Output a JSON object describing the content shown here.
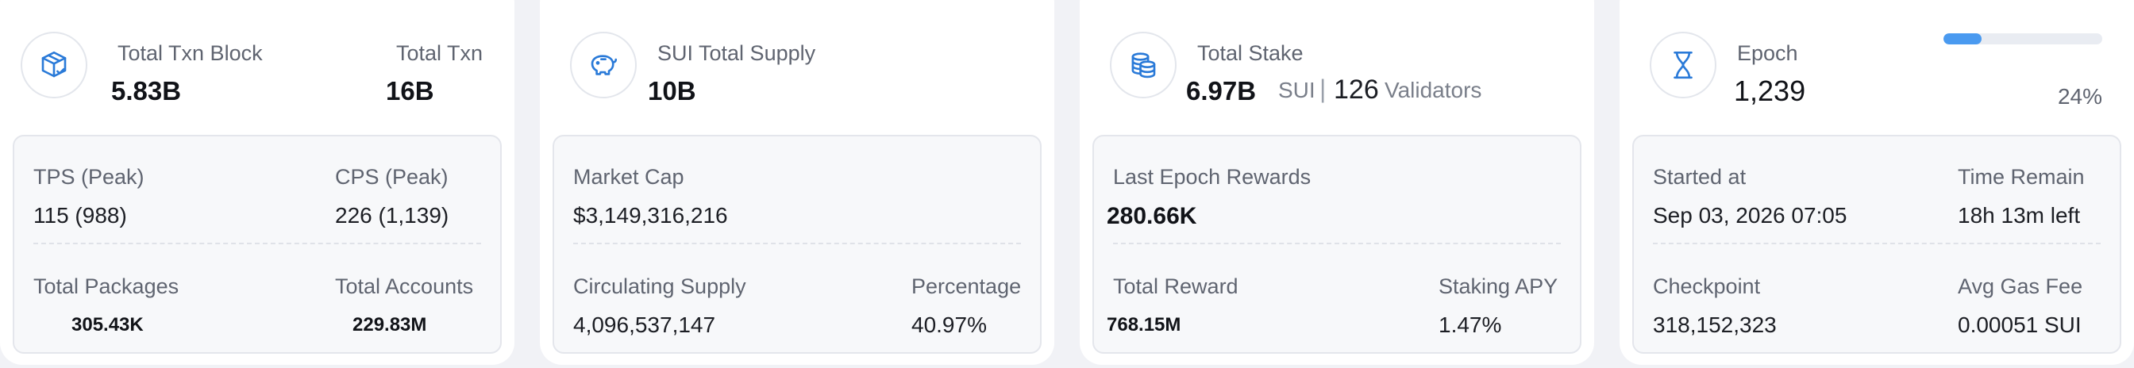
{
  "colors": {
    "accent": "#2a7ad8",
    "progress": "#4a9af0"
  },
  "txn": {
    "icon": "package-icon",
    "block_label": "Total Txn Block",
    "block_value": "5.83B",
    "txn_label": "Total Txn",
    "txn_value": "16B",
    "tps_label": "TPS (Peak)",
    "tps_value": "115 (988)",
    "cps_label": "CPS (Peak)",
    "cps_value": "226 (1,139)",
    "packages_label": "Total Packages",
    "packages_value": "305.43K",
    "accounts_label": "Total Accounts",
    "accounts_value": "229.83M"
  },
  "supply": {
    "icon": "piggy-bank-icon",
    "label": "SUI Total Supply",
    "value": "10B",
    "market_cap_label": "Market Cap",
    "market_cap_value": "$3,149,316,216",
    "circulating_label": "Circulating Supply",
    "circulating_value": "4,096,537,147",
    "percentage_label": "Percentage",
    "percentage_value": "40.97%"
  },
  "stake": {
    "icon": "coins-stack-icon",
    "label": "Total Stake",
    "value": "6.97B",
    "unit": "SUI",
    "separator": "|",
    "validators_count": "126",
    "validators_label": "Validators",
    "last_rewards_label": "Last Epoch Rewards",
    "last_rewards_value": "280.66K",
    "total_reward_label": "Total Reward",
    "total_reward_value": "768.15M",
    "apy_label": "Staking APY",
    "apy_value": "1.47%"
  },
  "epoch": {
    "icon": "hourglass-icon",
    "label": "Epoch",
    "value": "1,239",
    "progress_percent": 24,
    "progress_text": "24%",
    "started_label": "Started at",
    "started_value": "Sep 03, 2026 07:05",
    "remain_label": "Time Remain",
    "remain_value": "18h 13m left",
    "checkpoint_label": "Checkpoint",
    "checkpoint_value": "318,152,323",
    "gas_label": "Avg Gas Fee",
    "gas_value": "0.00051 SUI"
  }
}
